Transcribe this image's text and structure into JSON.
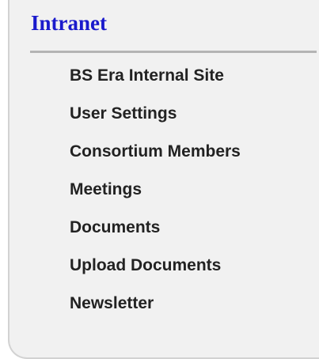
{
  "section": {
    "title": "Intranet"
  },
  "menu": {
    "items": [
      {
        "label": "BS Era Internal Site"
      },
      {
        "label": "User Settings"
      },
      {
        "label": "Consortium Members"
      },
      {
        "label": "Meetings"
      },
      {
        "label": "Documents"
      },
      {
        "label": "Upload Documents"
      },
      {
        "label": "Newsletter"
      }
    ]
  },
  "colors": {
    "title": "#1a1acc",
    "text": "#222222",
    "panel_background": "#f1f1f1",
    "divider": "#b4b4b4",
    "border": "#d2d2d2"
  }
}
